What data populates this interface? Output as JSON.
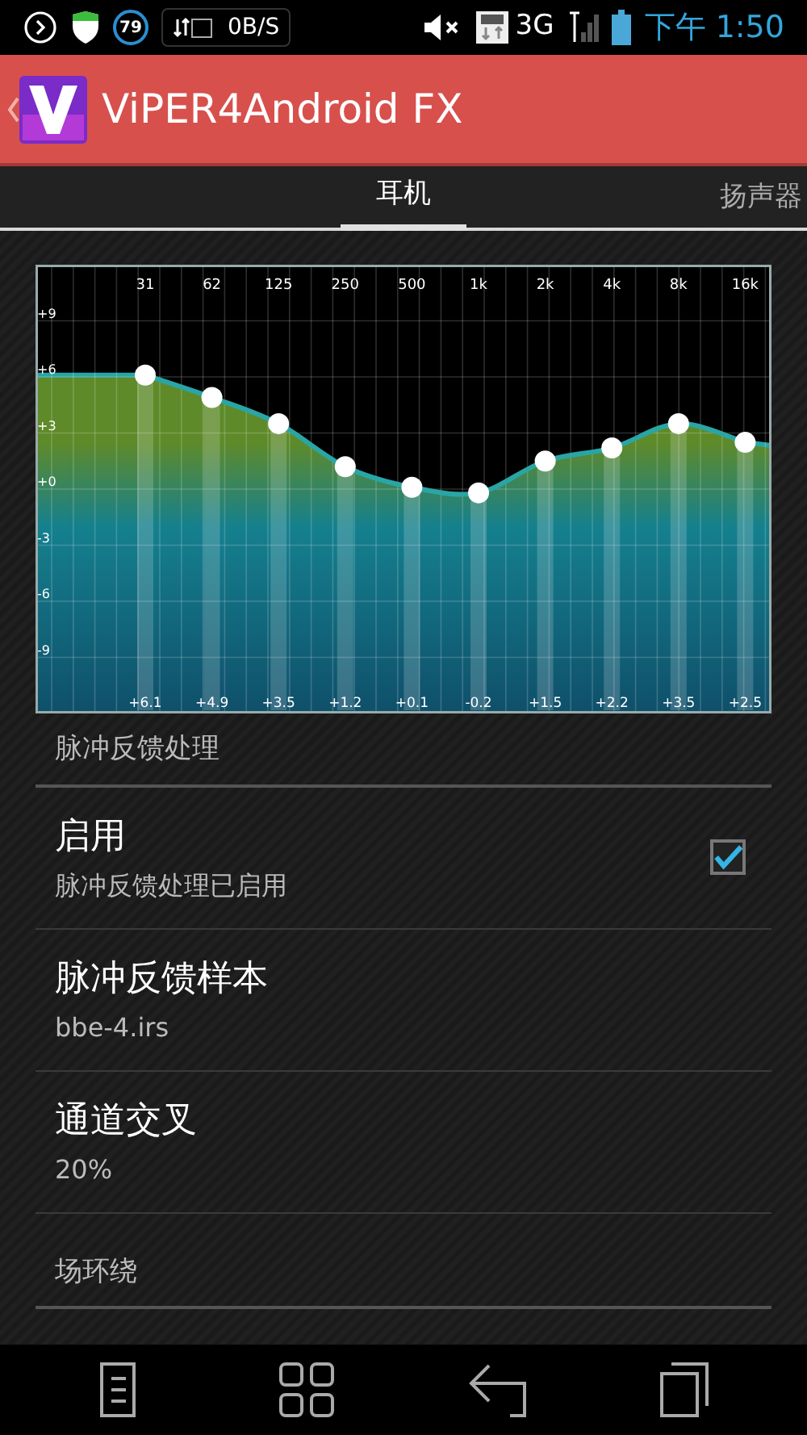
{
  "status_bar": {
    "badge": "79",
    "net_speed": "0B/S",
    "network": "3G",
    "time": "下午 1:50"
  },
  "action_bar": {
    "title": "ViPER4Android FX"
  },
  "tabs": [
    {
      "label": "耳机",
      "selected": true
    },
    {
      "label": "扬声器",
      "selected": false
    }
  ],
  "equalizer": {
    "chart_data": {
      "type": "line",
      "grid": true,
      "categories": [
        "31",
        "62",
        "125",
        "250",
        "500",
        "1k",
        "2k",
        "4k",
        "8k",
        "16k"
      ],
      "ylim": [
        -12,
        12
      ],
      "yticks": [
        {
          "value": 9,
          "label": "+9"
        },
        {
          "value": 6,
          "label": "+6"
        },
        {
          "value": 3,
          "label": "+3"
        },
        {
          "value": 0,
          "label": "+0"
        },
        {
          "value": -3,
          "label": "-3"
        },
        {
          "value": -6,
          "label": "-6"
        },
        {
          "value": -9,
          "label": "-9"
        }
      ],
      "series": [
        {
          "color": "#2aa5a5",
          "marker": "circle",
          "values": [
            6.1,
            4.9,
            3.5,
            1.2,
            0.1,
            -0.2,
            1.5,
            2.2,
            3.5,
            2.5
          ]
        }
      ],
      "value_labels": [
        "+6.1",
        "+4.9",
        "+3.5",
        "+1.2",
        "+0.1",
        "-0.2",
        "+1.5",
        "+2.2",
        "+3.5",
        "+2.5"
      ]
    }
  },
  "sections": [
    {
      "title": "脉冲反馈处理",
      "items": [
        {
          "kind": "checkbox",
          "title": "启用",
          "summary": "脉冲反馈处理已启用",
          "checked": true
        },
        {
          "kind": "plain",
          "title": "脉冲反馈样本",
          "summary": "bbe-4.irs"
        },
        {
          "kind": "plain",
          "title": "通道交叉",
          "summary": "20%"
        }
      ]
    },
    {
      "title": "场环绕"
    }
  ]
}
